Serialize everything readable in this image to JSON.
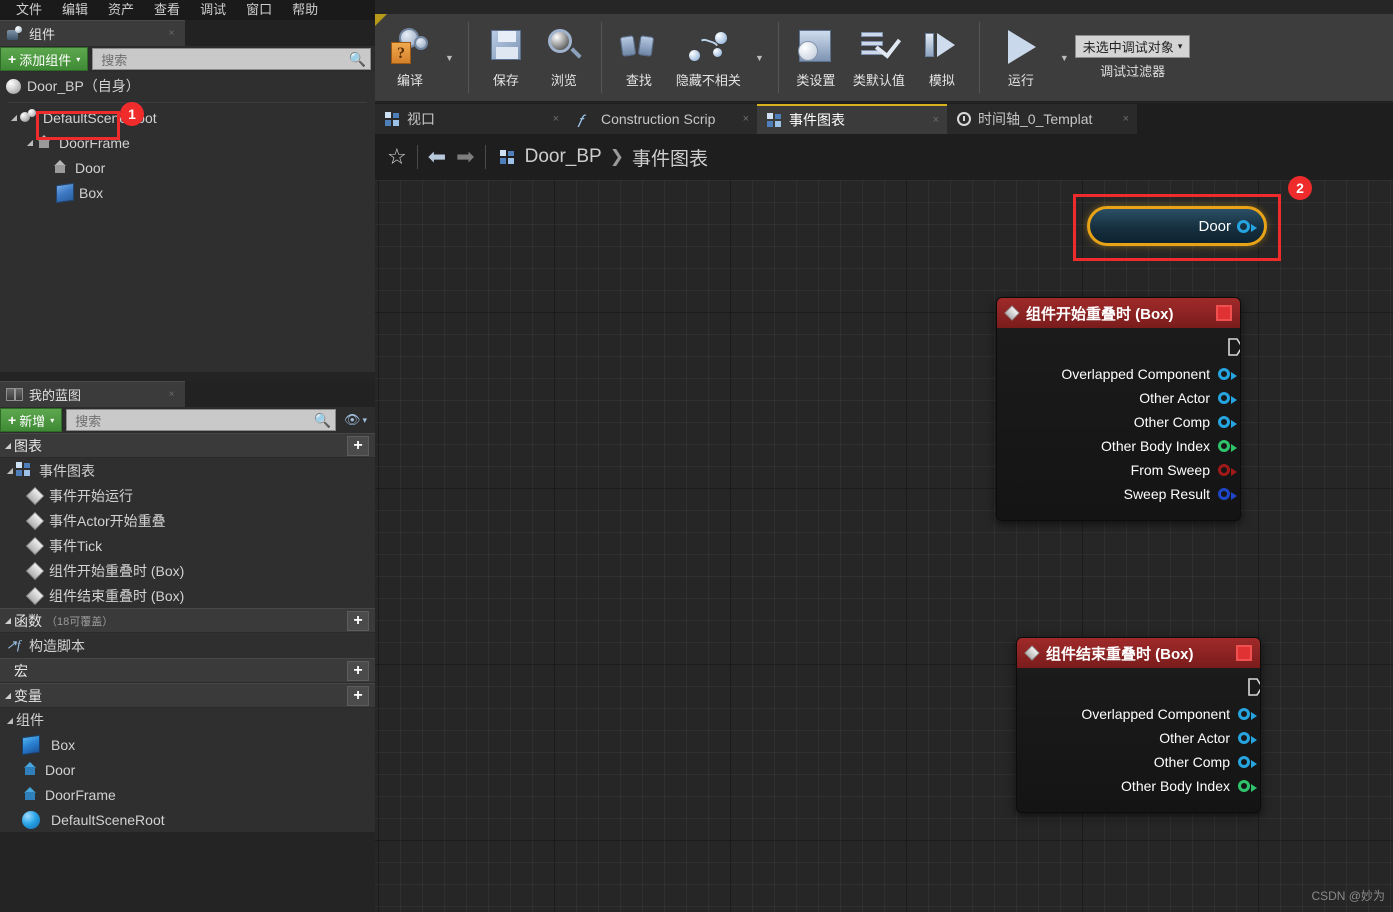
{
  "menu": {
    "items": [
      "文件",
      "编辑",
      "资产",
      "查看",
      "调试",
      "窗口",
      "帮助"
    ]
  },
  "components_panel": {
    "tab_title": "组件",
    "tab_icon": "components-icon",
    "close_label": "×",
    "add_button": "添加组件",
    "add_plus": "+",
    "add_caret": "▾",
    "search_placeholder": "搜索",
    "search_icon": "search-icon",
    "root_label": "Door_BP（自身）",
    "tree": [
      {
        "label": "DefaultSceneRoot",
        "icon": "scene-root-icon",
        "depth": 0,
        "arrow": "◢"
      },
      {
        "label": "DoorFrame",
        "icon": "static-mesh-icon",
        "depth": 1,
        "arrow": "◢"
      },
      {
        "label": "Door",
        "icon": "static-mesh-icon",
        "depth": 2,
        "arrow": ""
      },
      {
        "label": "Box",
        "icon": "box-collision-icon",
        "depth": 2,
        "arrow": ""
      }
    ],
    "highlight_badge": "1"
  },
  "myblueprint_panel": {
    "tab_title": "我的蓝图",
    "tab_icon": "book-icon",
    "close_label": "×",
    "add_button": "新增",
    "add_plus": "+",
    "add_caret": "▾",
    "search_placeholder": "搜索",
    "eye_icon": "eye-icon",
    "eye_caret": "▾",
    "sections": [
      {
        "title": "图表",
        "sub": "",
        "plus": "+",
        "arrow": "◢",
        "items": [
          {
            "label": "事件图表",
            "icon": "event-graph-icon",
            "depth": 0,
            "arrow": "◢"
          },
          {
            "label": "事件开始运行",
            "icon": "event-node-icon",
            "depth": 1,
            "arrow": ""
          },
          {
            "label": "事件Actor开始重叠",
            "icon": "event-node-icon",
            "depth": 1,
            "arrow": ""
          },
          {
            "label": "事件Tick",
            "icon": "event-node-icon",
            "depth": 1,
            "arrow": ""
          },
          {
            "label": "组件开始重叠时 (Box)",
            "icon": "event-node-icon",
            "depth": 1,
            "arrow": ""
          },
          {
            "label": "组件结束重叠时 (Box)",
            "icon": "event-node-icon",
            "depth": 1,
            "arrow": ""
          }
        ]
      },
      {
        "title": "函数",
        "sub": "（18可覆盖）",
        "plus": "+",
        "arrow": "◢",
        "items": [
          {
            "label": "构造脚本",
            "icon": "function-icon",
            "depth": 0,
            "arrow": ""
          }
        ]
      },
      {
        "title": "宏",
        "sub": "",
        "plus": "+",
        "arrow": "",
        "items": []
      },
      {
        "title": "变量",
        "sub": "",
        "plus": "+",
        "arrow": "◢",
        "items": [
          {
            "label": "组件",
            "icon": "",
            "depth": 0,
            "arrow": "◢",
            "group": true
          },
          {
            "label": "Box",
            "icon": "box-var-icon",
            "depth": 1,
            "arrow": ""
          },
          {
            "label": "Door",
            "icon": "mesh-var-icon",
            "depth": 1,
            "arrow": ""
          },
          {
            "label": "DoorFrame",
            "icon": "mesh-var-icon",
            "depth": 1,
            "arrow": ""
          },
          {
            "label": "DefaultSceneRoot",
            "icon": "scene-var-icon",
            "depth": 1,
            "arrow": ""
          }
        ]
      }
    ]
  },
  "toolbar": {
    "groups": [
      {
        "buttons": [
          {
            "label": "编译",
            "icon": "compile-icon",
            "caret": true
          }
        ]
      },
      {
        "buttons": [
          {
            "label": "保存",
            "icon": "save-icon",
            "caret": false
          },
          {
            "label": "浏览",
            "icon": "browse-icon",
            "caret": false
          }
        ]
      },
      {
        "buttons": [
          {
            "label": "查找",
            "icon": "find-icon",
            "caret": false
          },
          {
            "label": "隐藏不相关",
            "icon": "hide-unrelated-icon",
            "caret": true
          }
        ]
      },
      {
        "buttons": [
          {
            "label": "类设置",
            "icon": "class-settings-icon",
            "caret": false
          },
          {
            "label": "类默认值",
            "icon": "class-defaults-icon",
            "caret": false
          },
          {
            "label": "模拟",
            "icon": "simulate-icon",
            "caret": false
          }
        ]
      },
      {
        "buttons": [
          {
            "label": "运行",
            "icon": "play-icon",
            "caret": true
          }
        ]
      }
    ],
    "debug_select_value": "未选中调试对象",
    "debug_select_caret": "▾",
    "debug_filter_label": "调试过滤器"
  },
  "graph_tabs": [
    {
      "label": "视口",
      "icon": "viewport-icon",
      "active": false,
      "close": "×"
    },
    {
      "label": "Construction Scrip",
      "icon": "function-icon",
      "active": false,
      "close": "×"
    },
    {
      "label": "事件图表",
      "icon": "event-graph-icon",
      "active": true,
      "close": "×"
    },
    {
      "label": "时间轴_0_Templat",
      "icon": "clock-icon",
      "active": false,
      "close": "×"
    }
  ],
  "breadcrumb": {
    "star_icon": "favorite-star-icon",
    "back_icon": "back-arrow-icon",
    "forward_icon": "forward-arrow-icon",
    "graph_icon": "event-graph-icon",
    "blueprint": "Door_BP",
    "separator": "❯",
    "graph": "事件图表"
  },
  "graph_nodes": {
    "door_node": {
      "label": "Door",
      "badge": "2",
      "pin_icon": "output-object-pin"
    },
    "begin_overlap": {
      "title": "组件开始重叠时 (Box)",
      "diamond_icon": "event-diamond-icon",
      "stop_icon": "breakpoint-stop-icon",
      "exec_icon": "exec-out-pin",
      "pins": [
        {
          "label": "Overlapped Component",
          "color": "cyan"
        },
        {
          "label": "Other Actor",
          "color": "cyan"
        },
        {
          "label": "Other Comp",
          "color": "cyan"
        },
        {
          "label": "Other Body Index",
          "color": "green"
        },
        {
          "label": "From Sweep",
          "color": "red"
        },
        {
          "label": "Sweep Result",
          "color": "blue"
        }
      ]
    },
    "end_overlap": {
      "title": "组件结束重叠时 (Box)",
      "diamond_icon": "event-diamond-icon",
      "stop_icon": "breakpoint-stop-icon",
      "exec_icon": "exec-out-pin",
      "pins": [
        {
          "label": "Overlapped Component",
          "color": "cyan"
        },
        {
          "label": "Other Actor",
          "color": "cyan"
        },
        {
          "label": "Other Comp",
          "color": "cyan"
        },
        {
          "label": "Other Body Index",
          "color": "green"
        }
      ]
    }
  },
  "watermark": "CSDN @妙为",
  "colors": {
    "accent_yellow": "#d8b320",
    "highlight_red": "#f02b2b",
    "green_button": "#4f9a42",
    "event_header_red": "#a02a2a",
    "pin_cyan": "#25a4e0",
    "pin_green": "#2fc46b",
    "pin_red": "#a01a1a",
    "pin_blue": "#1f45c9",
    "node_border_orange": "#e8a317"
  }
}
